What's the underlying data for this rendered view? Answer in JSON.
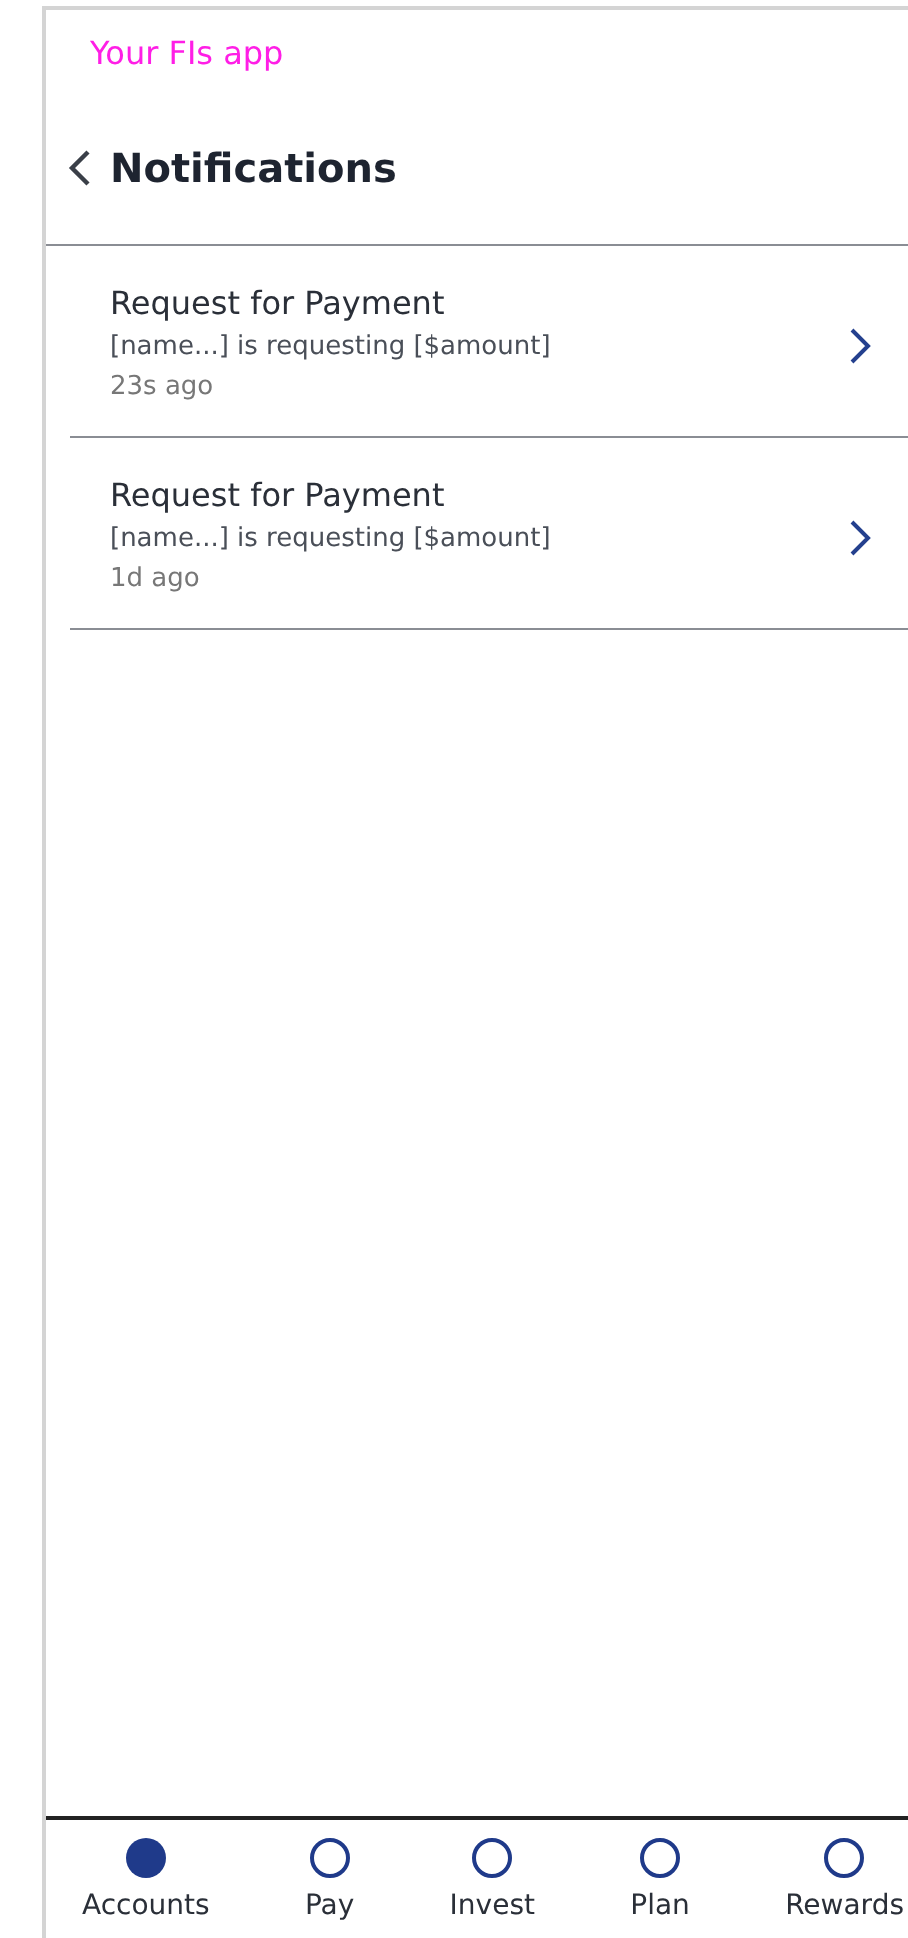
{
  "app_label": "Your FIs app",
  "header": {
    "title": "Notifications"
  },
  "notifications": [
    {
      "title": "Request for Payment",
      "message": "[name...] is requesting [$amount]",
      "time": "23s ago"
    },
    {
      "title": "Request for Payment",
      "message": "[name...] is requesting [$amount]",
      "time": "1d ago"
    }
  ],
  "nav": [
    {
      "label": "Accounts",
      "selected": true
    },
    {
      "label": "Pay",
      "selected": false
    },
    {
      "label": "Invest",
      "selected": false
    },
    {
      "label": "Plan",
      "selected": false
    },
    {
      "label": "Rewards",
      "selected": false
    }
  ]
}
